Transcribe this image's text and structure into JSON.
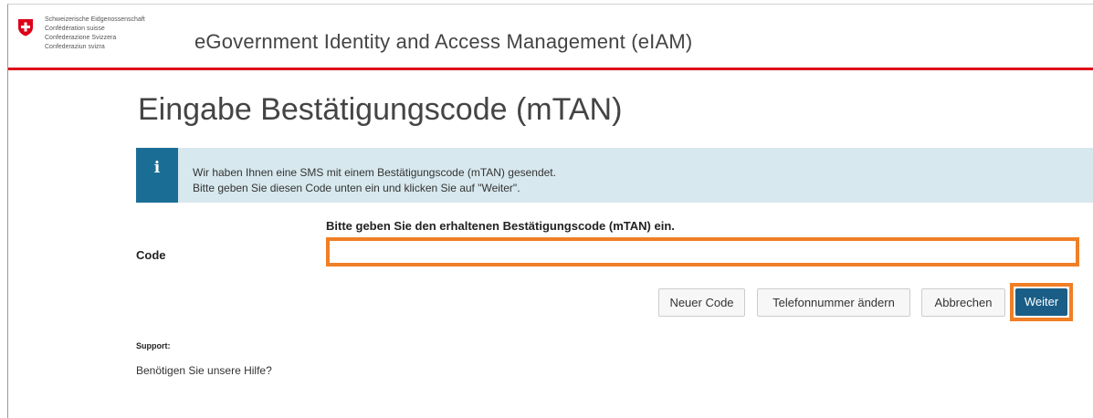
{
  "header": {
    "confederation_lines": [
      "Schweizerische Eidgenossenschaft",
      "Confédération suisse",
      "Confederazione Svizzera",
      "Confederaziun svizra"
    ],
    "app_title": "eGovernment Identity and Access Management (eIAM)"
  },
  "page": {
    "title": "Eingabe Bestätigungscode (mTAN)"
  },
  "info": {
    "icon": "info-icon",
    "line1": "Wir haben Ihnen eine SMS mit einem Bestätigungscode (mTAN) gesendet.",
    "line2": "Bitte geben Sie diesen Code unten ein und klicken Sie auf \"Weiter\"."
  },
  "form": {
    "code_label": "Code",
    "code_hint": "Bitte geben Sie den erhaltenen Bestätigungscode (mTAN) ein.",
    "code_value": "",
    "code_placeholder": ""
  },
  "buttons": {
    "new_code": "Neuer Code",
    "change_phone": "Telefonnummer ändern",
    "cancel": "Abbrechen",
    "next": "Weiter"
  },
  "support": {
    "label": "Support:",
    "help_text": "Benötigen Sie unsere Hilfe?"
  },
  "colors": {
    "swiss_red": "#dc0018",
    "info_blue": "#1a6e96",
    "info_bg": "#d7e8ee",
    "highlight_orange": "#f07f26",
    "primary_button": "#1a5e87"
  }
}
